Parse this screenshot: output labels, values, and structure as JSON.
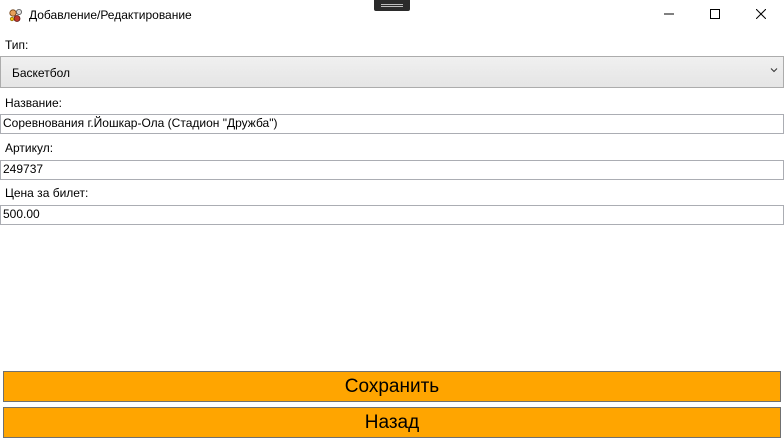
{
  "window": {
    "title": "Добавление/Редактирование"
  },
  "form": {
    "type_label": "Тип:",
    "type_value": "Баскетбол",
    "name_label": "Название:",
    "name_value": "Соревнования г.Йошкар-Ола (Стадион \"Дружба\")",
    "article_label": "Артикул:",
    "article_value": "249737",
    "price_label": "Цена за билет:",
    "price_value": "500.00"
  },
  "buttons": {
    "save_label": "Сохранить",
    "back_label": "Назад",
    "accent_color": "#ffa500"
  },
  "icons": {
    "app": "app-icon",
    "minimize": "minimize-icon",
    "maximize": "maximize-icon",
    "close": "close-icon",
    "combo": "chevron-down-icon"
  }
}
